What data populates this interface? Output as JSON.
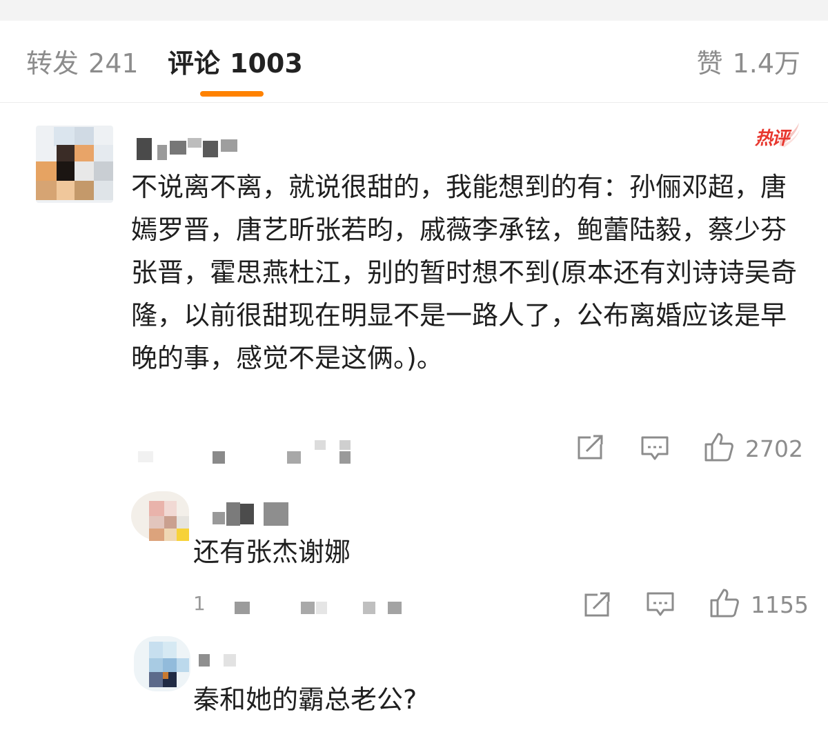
{
  "tabs": {
    "repost_label": "转发",
    "repost_count": "241",
    "comments_label": "评论",
    "comments_count": "1003",
    "likes_label": "赞",
    "likes_count": "1.4万"
  },
  "colors": {
    "accent": "#ff8200",
    "hot": "#e8372e",
    "muted": "#8c8c8c"
  },
  "main_comment": {
    "badge": "热评",
    "text": "不说离不离，就说很甜的，我能想到的有：孙俪邓超，唐嫣罗晋，唐艺昕张若昀，戚薇李承铉，鲍蕾陆毅，蔡少芬张晋，霍思燕杜江，别的暂时想不到(原本还有刘诗诗吴奇隆，以前很甜现在明显不是一路人了，公布离婚应该是早晚的事，感觉不是这俩。)。",
    "like_count": "2702",
    "icons": [
      "share-icon",
      "comment-icon",
      "thumbs-up-icon"
    ]
  },
  "replies": [
    {
      "text": "还有张杰谢娜",
      "number": "1",
      "like_count": "1155"
    },
    {
      "text": "秦和她的霸总老公?"
    }
  ]
}
